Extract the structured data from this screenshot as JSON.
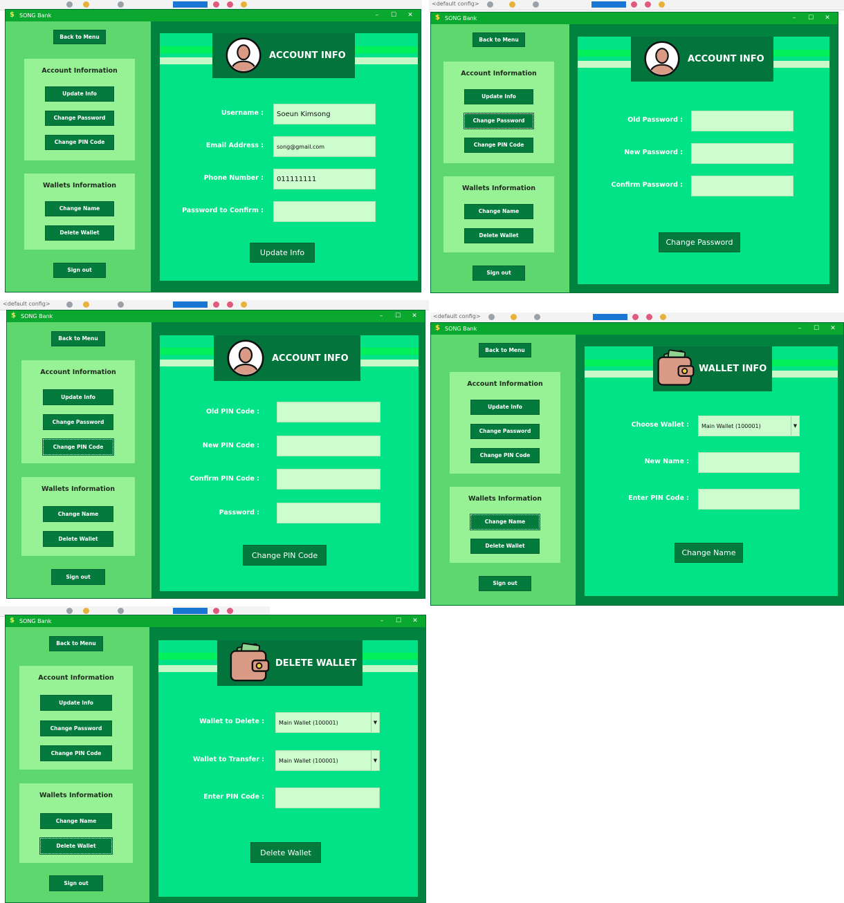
{
  "app": {
    "title": "SONG Bank",
    "logo_symbol": "$"
  },
  "window_controls": {
    "minimize": "–",
    "maximize": "☐",
    "close": "✕"
  },
  "ide": {
    "config_label": "<default config>"
  },
  "sidebar": {
    "back_to_menu": "Back to Menu",
    "account_group": {
      "title": "Account Information",
      "update_info": "Update Info",
      "change_password": "Change Password",
      "change_pin_code": "Change PIN Code"
    },
    "wallet_group": {
      "title": "Wallets Information",
      "change_name": "Change Name",
      "delete_wallet": "Delete Wallet"
    },
    "sign_out": "Sign out"
  },
  "panels": {
    "update_info": {
      "header": "ACCOUNT INFO",
      "username_label": "Username  :",
      "username_value": "Soeun Kimsong",
      "email_label": "Email Address  :",
      "email_value": "song@gmail.com",
      "phone_label": "Phone Number  :",
      "phone_value": "011111111",
      "password_label": "Password to Confirm  :",
      "password_value": "",
      "submit": "Update Info"
    },
    "change_password": {
      "header": "ACCOUNT INFO",
      "old_label": "Old Password  :",
      "new_label": "New Password  :",
      "confirm_label": "Confirm Password  :",
      "submit": "Change Password"
    },
    "change_pin": {
      "header": "ACCOUNT INFO",
      "old_label": "Old PIN Code  :",
      "new_label": "New PIN Code  :",
      "confirm_label": "Confirm PIN Code  :",
      "password_label": "Password  :",
      "submit": "Change PIN Code"
    },
    "change_name": {
      "header": "WALLET INFO",
      "choose_label": "Choose Wallet  :",
      "choose_value": "Main Wallet (100001)",
      "new_name_label": "New Name  :",
      "pin_label": "Enter PIN Code  :",
      "submit": "Change Name"
    },
    "delete_wallet": {
      "header": "DELETE WALLET",
      "wallet_delete_label": "Wallet to Delete  :",
      "wallet_delete_value": "Main Wallet (100001)",
      "wallet_transfer_label": "Wallet to Transfer  :",
      "wallet_transfer_value": "Main Wallet (100001)",
      "pin_label": "Enter PIN Code  :",
      "submit": "Delete Wallet"
    }
  },
  "colors": {
    "titlebar": "#0aa82e",
    "sidebar": "#5ed86e",
    "group_panel": "#96f295",
    "button": "#047a3d",
    "content_frame": "#01823f",
    "content_panel": "#01e386",
    "header_box": "#03743b",
    "input": "#cdfccf"
  },
  "icons": [
    "dollar-logo-icon",
    "user-avatar-icon",
    "wallet-icon",
    "dropdown-arrow-icon"
  ]
}
